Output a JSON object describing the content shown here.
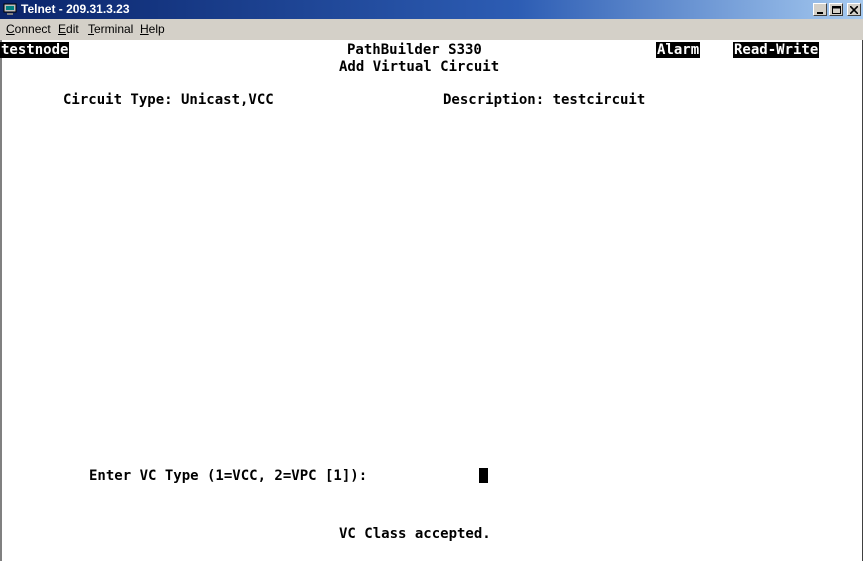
{
  "window": {
    "title": "Telnet - 209.31.3.23",
    "icons": {
      "app": "telnet-icon",
      "minimize": "minimize-icon",
      "maximize": "maximize-icon",
      "close": "close-icon"
    }
  },
  "menu": {
    "connect": {
      "mnemonic": "C",
      "rest": "onnect"
    },
    "edit": {
      "mnemonic": "E",
      "rest": "dit"
    },
    "terminal": {
      "mnemonic": "T",
      "rest": "erminal"
    },
    "help": {
      "mnemonic": "H",
      "rest": "elp"
    }
  },
  "terminal": {
    "node_name": "testnode",
    "product": "PathBuilder S330",
    "screen_title": "Add Virtual Circuit",
    "alarm": "Alarm",
    "access_mode": "Read-Write",
    "circuit_type_line": "Circuit Type: Unicast,VCC",
    "description_line": "Description: testcircuit",
    "prompt": "Enter VC Type (1=VCC, 2=VPC [1]):",
    "status_message": "VC Class accepted."
  },
  "colors": {
    "titlebar_start": "#0a246a",
    "titlebar_end": "#a6caf0",
    "chrome": "#d4d0c8",
    "terminal_bg": "#ffffff",
    "terminal_fg": "#000000"
  }
}
